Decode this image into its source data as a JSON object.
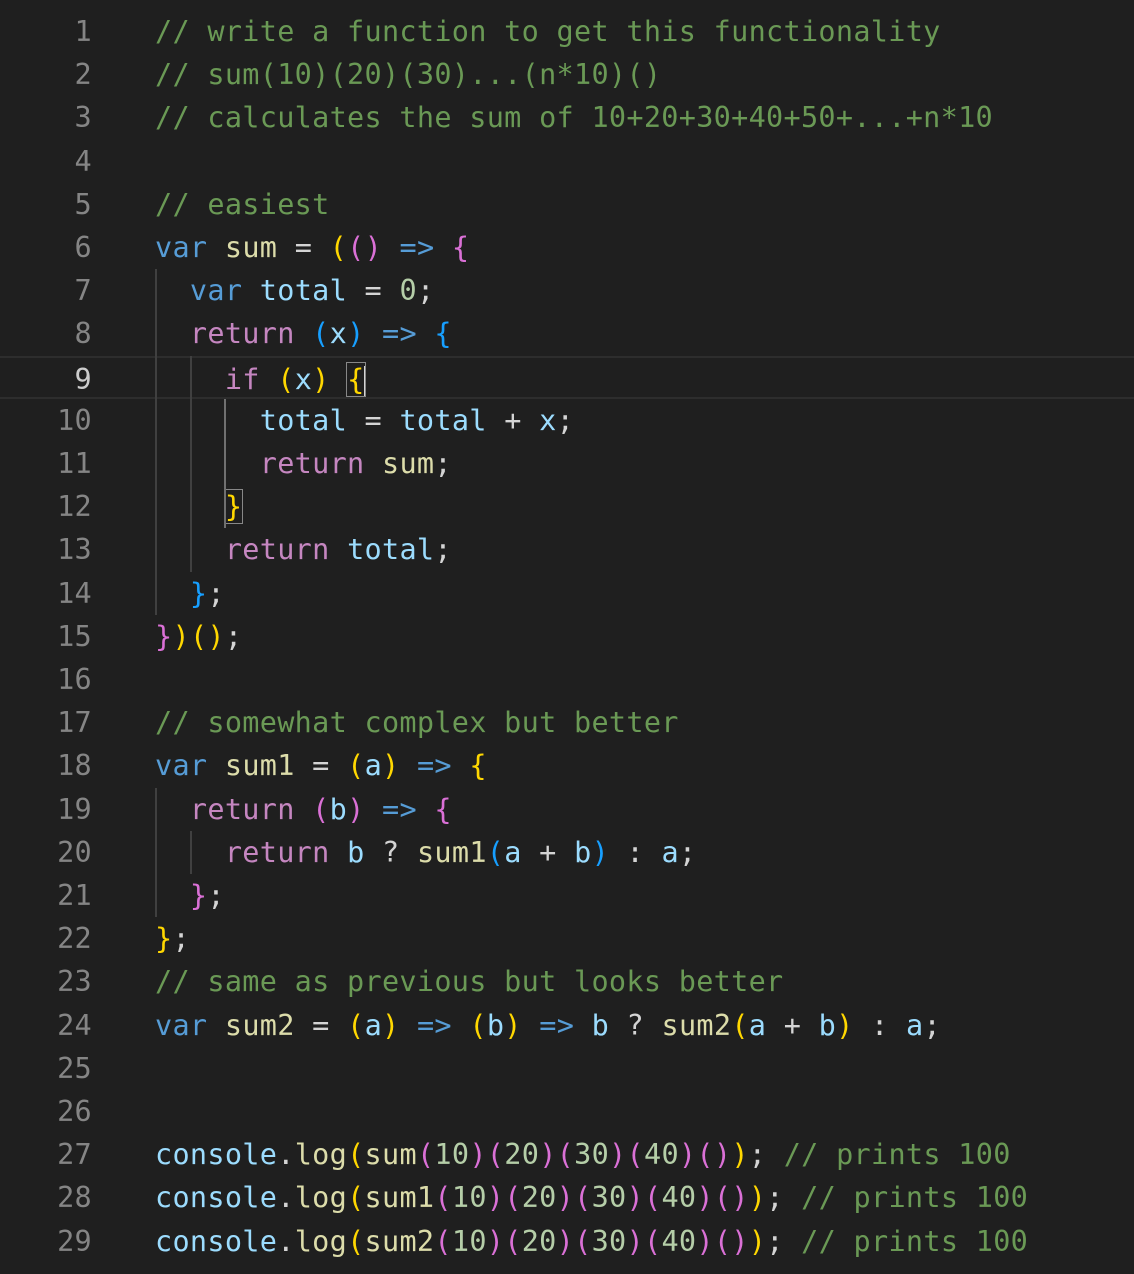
{
  "editor": {
    "active_line": 9,
    "colors": {
      "background": "#1f1f1f",
      "line_number": "#858585",
      "line_number_active": "#cccccc",
      "comment": "#6a9955",
      "keyword_storage": "#569cd6",
      "keyword_control": "#c586c0",
      "variable": "#9cdcfe",
      "function": "#dcdcaa",
      "number": "#b5cea8",
      "operator": "#d4d4d4",
      "bracket_1": "#ffd700",
      "bracket_2": "#da70d6",
      "bracket_3": "#179fff"
    },
    "lines": [
      {
        "num": "1",
        "tokens": [
          [
            "// write a function to get this functionality",
            "comment"
          ]
        ]
      },
      {
        "num": "2",
        "tokens": [
          [
            "// sum(10)(20)(30)...(n*10)()",
            "comment"
          ]
        ]
      },
      {
        "num": "3",
        "tokens": [
          [
            "// calculates the sum of 10+20+30+40+50+...+n*10",
            "comment"
          ]
        ]
      },
      {
        "num": "4",
        "tokens": []
      },
      {
        "num": "5",
        "tokens": [
          [
            "// easiest",
            "comment"
          ]
        ]
      },
      {
        "num": "6",
        "tokens": [
          [
            "var",
            "storage"
          ],
          [
            " ",
            "op"
          ],
          [
            "sum",
            "func"
          ],
          [
            " = ",
            "op"
          ],
          [
            "(",
            "b1"
          ],
          [
            "(",
            "b2"
          ],
          [
            ")",
            "b2"
          ],
          [
            " ",
            "op"
          ],
          [
            "=>",
            "storage"
          ],
          [
            " ",
            "op"
          ],
          [
            "{",
            "b2"
          ]
        ]
      },
      {
        "num": "7",
        "tokens": [
          [
            "  ",
            "op"
          ],
          [
            "var",
            "storage"
          ],
          [
            " ",
            "op"
          ],
          [
            "total",
            "var"
          ],
          [
            " = ",
            "op"
          ],
          [
            "0",
            "num"
          ],
          [
            ";",
            "op"
          ]
        ]
      },
      {
        "num": "8",
        "tokens": [
          [
            "  ",
            "op"
          ],
          [
            "return",
            "control"
          ],
          [
            " ",
            "op"
          ],
          [
            "(",
            "b3"
          ],
          [
            "x",
            "var"
          ],
          [
            ")",
            "b3"
          ],
          [
            " ",
            "op"
          ],
          [
            "=>",
            "storage"
          ],
          [
            " ",
            "op"
          ],
          [
            "{",
            "b3"
          ]
        ]
      },
      {
        "num": "9",
        "tokens": [
          [
            "    ",
            "op"
          ],
          [
            "if",
            "control"
          ],
          [
            " ",
            "op"
          ],
          [
            "(",
            "b1"
          ],
          [
            "x",
            "var"
          ],
          [
            ")",
            "b1"
          ],
          [
            " ",
            "op"
          ],
          [
            "{",
            "b1match"
          ],
          [
            "",
            "caret"
          ]
        ]
      },
      {
        "num": "10",
        "tokens": [
          [
            "      ",
            "op"
          ],
          [
            "total",
            "var"
          ],
          [
            " = ",
            "op"
          ],
          [
            "total",
            "var"
          ],
          [
            " + ",
            "op"
          ],
          [
            "x",
            "var"
          ],
          [
            ";",
            "op"
          ]
        ]
      },
      {
        "num": "11",
        "tokens": [
          [
            "      ",
            "op"
          ],
          [
            "return",
            "control"
          ],
          [
            " ",
            "op"
          ],
          [
            "sum",
            "func"
          ],
          [
            ";",
            "op"
          ]
        ]
      },
      {
        "num": "12",
        "tokens": [
          [
            "    ",
            "op"
          ],
          [
            "}",
            "b1match"
          ]
        ]
      },
      {
        "num": "13",
        "tokens": [
          [
            "    ",
            "op"
          ],
          [
            "return",
            "control"
          ],
          [
            " ",
            "op"
          ],
          [
            "total",
            "var"
          ],
          [
            ";",
            "op"
          ]
        ]
      },
      {
        "num": "14",
        "tokens": [
          [
            "  ",
            "op"
          ],
          [
            "}",
            "b3"
          ],
          [
            ";",
            "op"
          ]
        ]
      },
      {
        "num": "15",
        "tokens": [
          [
            "}",
            "b2"
          ],
          [
            ")",
            "b1"
          ],
          [
            "(",
            "b1"
          ],
          [
            ")",
            "b1"
          ],
          [
            ";",
            "op"
          ]
        ]
      },
      {
        "num": "16",
        "tokens": []
      },
      {
        "num": "17",
        "tokens": [
          [
            "// somewhat complex but better",
            "comment"
          ]
        ]
      },
      {
        "num": "18",
        "tokens": [
          [
            "var",
            "storage"
          ],
          [
            " ",
            "op"
          ],
          [
            "sum1",
            "func"
          ],
          [
            " = ",
            "op"
          ],
          [
            "(",
            "b1"
          ],
          [
            "a",
            "var"
          ],
          [
            ")",
            "b1"
          ],
          [
            " ",
            "op"
          ],
          [
            "=>",
            "storage"
          ],
          [
            " ",
            "op"
          ],
          [
            "{",
            "b1"
          ]
        ]
      },
      {
        "num": "19",
        "tokens": [
          [
            "  ",
            "op"
          ],
          [
            "return",
            "control"
          ],
          [
            " ",
            "op"
          ],
          [
            "(",
            "b2"
          ],
          [
            "b",
            "var"
          ],
          [
            ")",
            "b2"
          ],
          [
            " ",
            "op"
          ],
          [
            "=>",
            "storage"
          ],
          [
            " ",
            "op"
          ],
          [
            "{",
            "b2"
          ]
        ]
      },
      {
        "num": "20",
        "tokens": [
          [
            "    ",
            "op"
          ],
          [
            "return",
            "control"
          ],
          [
            " ",
            "op"
          ],
          [
            "b",
            "var"
          ],
          [
            " ? ",
            "op"
          ],
          [
            "sum1",
            "func"
          ],
          [
            "(",
            "b3"
          ],
          [
            "a",
            "var"
          ],
          [
            " + ",
            "op"
          ],
          [
            "b",
            "var"
          ],
          [
            ")",
            "b3"
          ],
          [
            " : ",
            "op"
          ],
          [
            "a",
            "var"
          ],
          [
            ";",
            "op"
          ]
        ]
      },
      {
        "num": "21",
        "tokens": [
          [
            "  ",
            "op"
          ],
          [
            "}",
            "b2"
          ],
          [
            ";",
            "op"
          ]
        ]
      },
      {
        "num": "22",
        "tokens": [
          [
            "}",
            "b1"
          ],
          [
            ";",
            "op"
          ]
        ]
      },
      {
        "num": "23",
        "tokens": [
          [
            "// same as previous but looks better",
            "comment"
          ]
        ]
      },
      {
        "num": "24",
        "tokens": [
          [
            "var",
            "storage"
          ],
          [
            " ",
            "op"
          ],
          [
            "sum2",
            "func"
          ],
          [
            " = ",
            "op"
          ],
          [
            "(",
            "b1"
          ],
          [
            "a",
            "var"
          ],
          [
            ")",
            "b1"
          ],
          [
            " ",
            "op"
          ],
          [
            "=>",
            "storage"
          ],
          [
            " ",
            "op"
          ],
          [
            "(",
            "b1"
          ],
          [
            "b",
            "var"
          ],
          [
            ")",
            "b1"
          ],
          [
            " ",
            "op"
          ],
          [
            "=>",
            "storage"
          ],
          [
            " ",
            "op"
          ],
          [
            "b",
            "var"
          ],
          [
            " ? ",
            "op"
          ],
          [
            "sum2",
            "func"
          ],
          [
            "(",
            "b1"
          ],
          [
            "a",
            "var"
          ],
          [
            " + ",
            "op"
          ],
          [
            "b",
            "var"
          ],
          [
            ")",
            "b1"
          ],
          [
            " : ",
            "op"
          ],
          [
            "a",
            "var"
          ],
          [
            ";",
            "op"
          ]
        ]
      },
      {
        "num": "25",
        "tokens": []
      },
      {
        "num": "26",
        "tokens": []
      },
      {
        "num": "27",
        "tokens": [
          [
            "console",
            "var"
          ],
          [
            ".",
            "op"
          ],
          [
            "log",
            "func"
          ],
          [
            "(",
            "b1"
          ],
          [
            "sum",
            "func"
          ],
          [
            "(",
            "b2"
          ],
          [
            "10",
            "num"
          ],
          [
            ")",
            "b2"
          ],
          [
            "(",
            "b2"
          ],
          [
            "20",
            "num"
          ],
          [
            ")",
            "b2"
          ],
          [
            "(",
            "b2"
          ],
          [
            "30",
            "num"
          ],
          [
            ")",
            "b2"
          ],
          [
            "(",
            "b2"
          ],
          [
            "40",
            "num"
          ],
          [
            ")",
            "b2"
          ],
          [
            "(",
            "b2"
          ],
          [
            ")",
            "b2"
          ],
          [
            ")",
            "b1"
          ],
          [
            "; ",
            "op"
          ],
          [
            "// prints 100",
            "comment"
          ]
        ]
      },
      {
        "num": "28",
        "tokens": [
          [
            "console",
            "var"
          ],
          [
            ".",
            "op"
          ],
          [
            "log",
            "func"
          ],
          [
            "(",
            "b1"
          ],
          [
            "sum1",
            "func"
          ],
          [
            "(",
            "b2"
          ],
          [
            "10",
            "num"
          ],
          [
            ")",
            "b2"
          ],
          [
            "(",
            "b2"
          ],
          [
            "20",
            "num"
          ],
          [
            ")",
            "b2"
          ],
          [
            "(",
            "b2"
          ],
          [
            "30",
            "num"
          ],
          [
            ")",
            "b2"
          ],
          [
            "(",
            "b2"
          ],
          [
            "40",
            "num"
          ],
          [
            ")",
            "b2"
          ],
          [
            "(",
            "b2"
          ],
          [
            ")",
            "b2"
          ],
          [
            ")",
            "b1"
          ],
          [
            "; ",
            "op"
          ],
          [
            "// prints 100",
            "comment"
          ]
        ]
      },
      {
        "num": "29",
        "tokens": [
          [
            "console",
            "var"
          ],
          [
            ".",
            "op"
          ],
          [
            "log",
            "func"
          ],
          [
            "(",
            "b1"
          ],
          [
            "sum2",
            "func"
          ],
          [
            "(",
            "b2"
          ],
          [
            "10",
            "num"
          ],
          [
            ")",
            "b2"
          ],
          [
            "(",
            "b2"
          ],
          [
            "20",
            "num"
          ],
          [
            ")",
            "b2"
          ],
          [
            "(",
            "b2"
          ],
          [
            "30",
            "num"
          ],
          [
            ")",
            "b2"
          ],
          [
            "(",
            "b2"
          ],
          [
            "40",
            "num"
          ],
          [
            ")",
            "b2"
          ],
          [
            "(",
            "b2"
          ],
          [
            ")",
            "b2"
          ],
          [
            ")",
            "b1"
          ],
          [
            "; ",
            "op"
          ],
          [
            "// prints 100",
            "comment"
          ]
        ]
      }
    ]
  }
}
